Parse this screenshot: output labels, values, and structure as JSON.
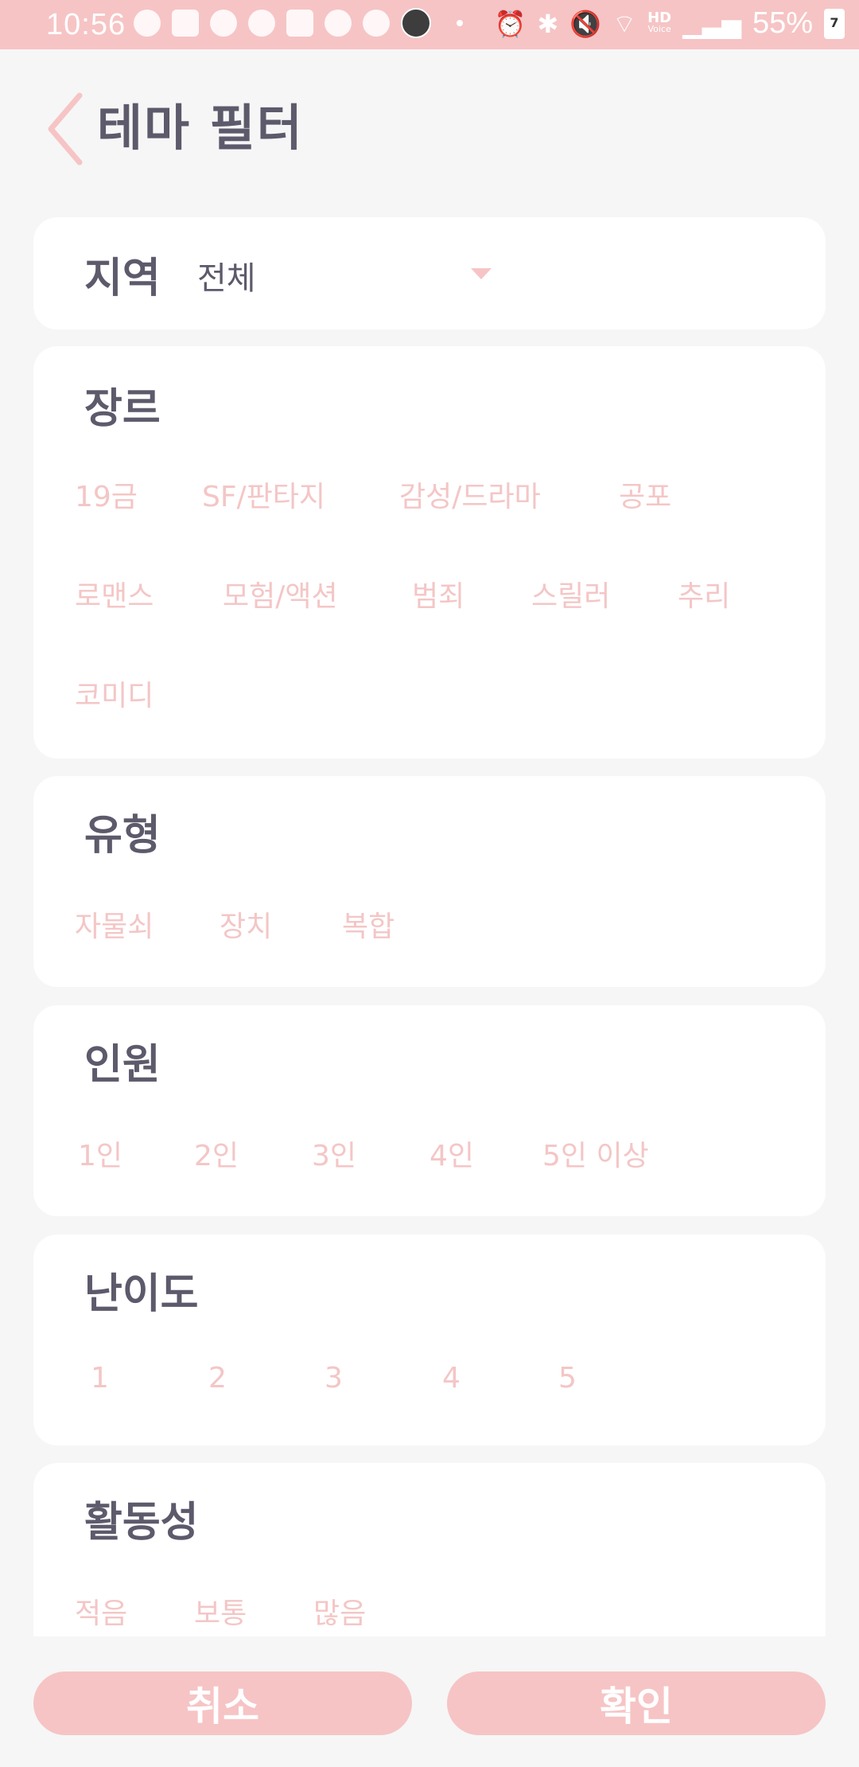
{
  "status_bar": {
    "time": "10:56",
    "hd_label": "HD",
    "voice_label": "Voice",
    "battery_text": "55%",
    "battery_badge": "7",
    "bg_color": "#f6c4c5"
  },
  "header": {
    "title": "테마 필터"
  },
  "region": {
    "label": "지역",
    "value": "전체"
  },
  "genre": {
    "title": "장르",
    "options": [
      "19금",
      "SF/판타지",
      "감성/드라마",
      "공포",
      "로맨스",
      "모험/액션",
      "범죄",
      "스릴러",
      "추리",
      "코미디"
    ]
  },
  "type": {
    "title": "유형",
    "options": [
      "자물쇠",
      "장치",
      "복합"
    ]
  },
  "people": {
    "title": "인원",
    "options": [
      "1인",
      "2인",
      "3인",
      "4인",
      "5인 이상"
    ]
  },
  "difficulty": {
    "title": "난이도",
    "options": [
      "1",
      "2",
      "3",
      "4",
      "5"
    ]
  },
  "activity": {
    "title": "활동성",
    "options": [
      "적음",
      "보통",
      "많음"
    ]
  },
  "buttons": {
    "cancel": "취소",
    "confirm": "확인"
  },
  "colors": {
    "accent": "#f6c4c5",
    "chip_text": "#f4c6c6",
    "title_text": "#5c5a6b",
    "background": "#f6f6f6"
  }
}
